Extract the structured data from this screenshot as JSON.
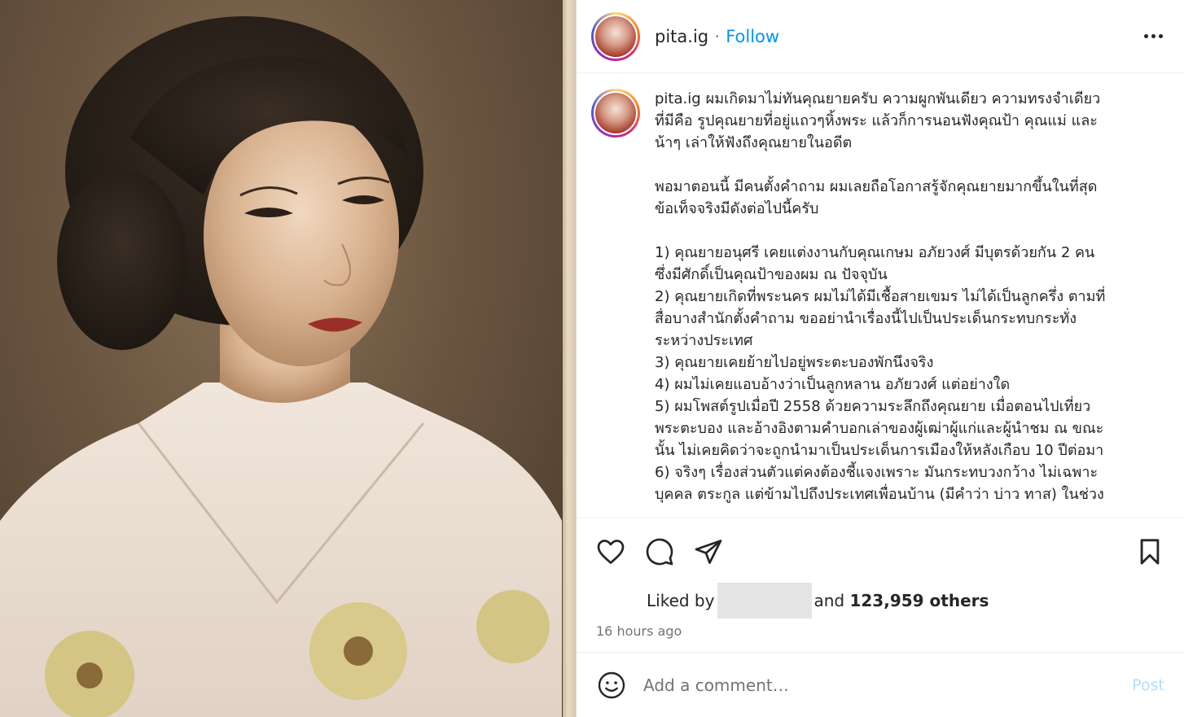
{
  "header": {
    "username": "pita.ig",
    "separator": "·",
    "follow_label": "Follow"
  },
  "caption": {
    "username": "pita.ig",
    "lines": [
      "ผมเกิดมาไม่ทันคุณยายครับ ความผูกพันเดียว ความทรงจำเดียว",
      "ที่มีคือ รูปคุณยายที่อยู่แถวๆหิ้งพระ แล้วก็การนอนฟังคุณป้า คุณแม่ และ",
      "น้าๆ เล่าให้ฟังถึงคุณยายในอดีต",
      "",
      "พอมาตอนนี้ มีคนตั้งคำถาม ผมเลยถือโอกาสรู้จักคุณยายมากขึ้นในที่สุด",
      "ข้อเท็จจริงมีดังต่อไปนี้ครับ",
      "",
      "1) คุณยายอนุศรี เคยแต่งงานกับคุณเกษม อภัยวงศ์ มีบุตรด้วยกัน 2 คน",
      "ซึ่งมีศักดิ์เป็นคุณป้าของผม ณ ปัจจุบัน",
      "2) คุณยายเกิดที่พระนคร ผมไม่ได้มีเชื้อสายเขมร ไม่ได้เป็นลูกครึ่ง ตามที่",
      "สื่อบางสำนักตั้งคำถาม ขออย่านำเรื่องนี้ไปเป็นประเด็นกระทบกระทั่ง",
      "ระหว่างประเทศ",
      "3) คุณยายเคยย้ายไปอยู่พระตะบองพักนึงจริง",
      "4) ผมไม่เคยแอบอ้างว่าเป็นลูกหลาน อภัยวงศ์ แต่อย่างใด",
      "5) ผมโพสต์รูปเมื่อปี 2558 ด้วยความระลึกถึงคุณยาย เมื่อตอนไปเที่ยว",
      "พระตะบอง และอ้างอิงตามคำบอกเล่าของผู้เฒ่าผู้แก่และผู้นำชม ณ ขณะ",
      "นั้น ไม่เคยคิดว่าจะถูกนำมาเป็นประเด็นการเมืองให้หลังเกือบ 10 ปีต่อมา",
      "6) จริงๆ เรื่องส่วนตัวแต่คงต้องชี้แจงเพราะ มันกระทบวงกว้าง ไม่เฉพาะ",
      "บุคคล ตระกูล แต่ข้ามไปถึงประเทศเพื่อนบ้าน (มีคำว่า บ่าว ทาส) ในช่วง"
    ]
  },
  "actions": {
    "like_icon": "heart-icon",
    "comment_icon": "comment-icon",
    "share_icon": "paper-plane-icon",
    "save_icon": "bookmark-icon"
  },
  "likes": {
    "prefix": "Liked by",
    "middle": "and",
    "count_text": "123,959 others"
  },
  "timestamp": "16 hours ago",
  "comment": {
    "placeholder": "Add a comment…",
    "post_label": "Post",
    "emoji_icon": "smiley-icon"
  },
  "colors": {
    "link_blue": "#0095f6",
    "post_disabled": "#b2dffc",
    "muted": "#737373"
  }
}
